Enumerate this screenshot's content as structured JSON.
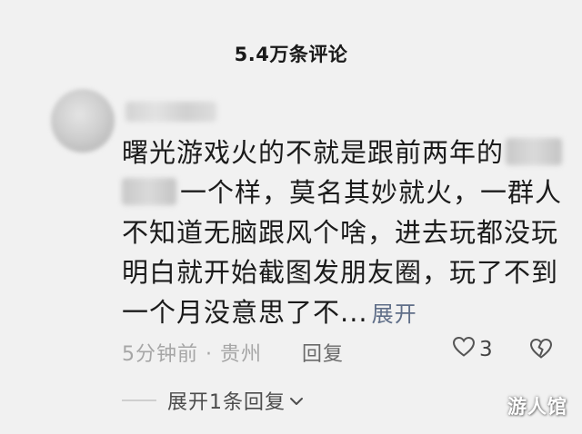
{
  "header": {
    "title": "5.4万条评论"
  },
  "comment": {
    "text_line1_a": "曙光游戏火的不就是跟前两年的",
    "text_line2_b": "一个样，莫名其妙就火，一群人",
    "text_line3": "不知道无脑跟风个啥，进去玩都没玩",
    "text_line4": "明白就开始截图发朋友圈，玩了不到",
    "text_line5": "一个月没意思了不...",
    "expand_label": "展开",
    "meta": "5分钟前 · 贵州",
    "reply_label": "回复",
    "like_count": "3"
  },
  "replies": {
    "label": "展开1条回复"
  },
  "watermark": {
    "text": "游人馆"
  },
  "icons": {
    "like": "heart-outline-icon",
    "dislike": "broken-heart-icon",
    "expand_replies": "chevron-down-icon"
  },
  "colors": {
    "background": "#f1f1f1",
    "text": "#1b1b1b",
    "expand_link": "#5f6e88",
    "meta": "#a6a6a6"
  }
}
